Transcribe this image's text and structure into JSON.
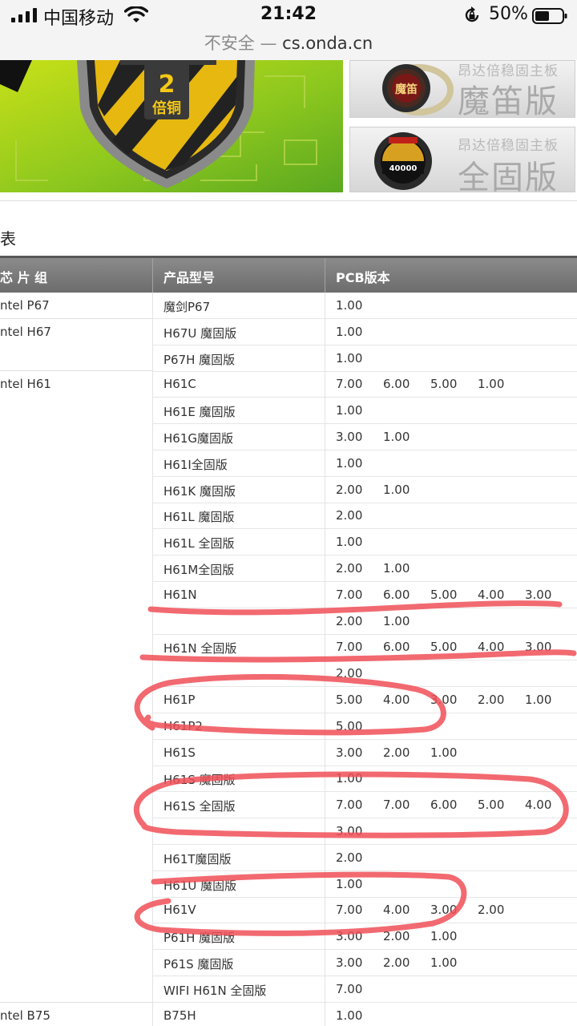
{
  "status_bar": {
    "carrier": "中国移动",
    "time": "21:42",
    "battery": "50%"
  },
  "address_bar": {
    "insecure": "不安全 —",
    "domain": "cs.onda.cn"
  },
  "banner": {
    "badge_top": "2",
    "badge_bottom": "倍铜",
    "thumbs": [
      {
        "sub": "昂达倍稳固主板",
        "title": "魔笛版",
        "badge": "魔笛"
      },
      {
        "sub": "昂达倍稳固主板",
        "title": "全固版",
        "badge": "40000"
      }
    ]
  },
  "section": {
    "title": "表"
  },
  "table": {
    "headers": [
      "芯片组",
      "产品型号",
      "PCB版本"
    ],
    "header_chip_visible": "芯 片 组",
    "groups": [
      {
        "chipset": "ntel P67",
        "start": 0,
        "span": 1
      },
      {
        "chipset": "ntel H67",
        "start": 1,
        "span": 2
      },
      {
        "chipset": "ntel H61",
        "start": 3,
        "span": 24
      },
      {
        "chipset": "ntel B75",
        "start": 27,
        "span": 1
      }
    ],
    "rows": [
      {
        "model": "魔剑P67",
        "versions": [
          "1.00"
        ]
      },
      {
        "model": "H67U 魔固版",
        "versions": [
          "1.00"
        ]
      },
      {
        "model": "P67H 魔固版",
        "versions": [
          "1.00"
        ]
      },
      {
        "model": "H61C",
        "versions": [
          "7.00",
          "6.00",
          "5.00",
          "1.00"
        ]
      },
      {
        "model": "H61E 魔固版",
        "versions": [
          "1.00"
        ]
      },
      {
        "model": "H61G魔固版",
        "versions": [
          "3.00",
          "1.00"
        ]
      },
      {
        "model": "H61I全固版",
        "versions": [
          "1.00"
        ]
      },
      {
        "model": "H61K 魔固版",
        "versions": [
          "2.00",
          "1.00"
        ]
      },
      {
        "model": "H61L 魔固版",
        "versions": [
          "2.00"
        ]
      },
      {
        "model": "H61L 全固版",
        "versions": [
          "1.00"
        ]
      },
      {
        "model": "H61M全固版",
        "versions": [
          "2.00",
          "1.00"
        ]
      },
      {
        "model": "H61N",
        "versions": [
          "7.00",
          "6.00",
          "5.00",
          "4.00",
          "3.00"
        ]
      },
      {
        "model": "",
        "versions": [
          "2.00",
          "1.00"
        ]
      },
      {
        "model": "H61N 全固版",
        "versions": [
          "7.00",
          "6.00",
          "5.00",
          "4.00",
          "3.00"
        ]
      },
      {
        "model": "",
        "versions": [
          "2.00"
        ]
      },
      {
        "model": "H61P",
        "versions": [
          "5.00",
          "4.00",
          "3.00",
          "2.00",
          "1.00"
        ]
      },
      {
        "model": "H61P2",
        "versions": [
          "5.00"
        ]
      },
      {
        "model": "H61S",
        "versions": [
          "3.00",
          "2.00",
          "1.00"
        ]
      },
      {
        "model": "H61S 魔固版",
        "versions": [
          "1.00"
        ]
      },
      {
        "model": "H61S 全固版",
        "versions": [
          "7.00",
          "7.00",
          "6.00",
          "5.00",
          "4.00"
        ]
      },
      {
        "model": "",
        "versions": [
          "3.00"
        ]
      },
      {
        "model": "H61T魔固版",
        "versions": [
          "2.00"
        ]
      },
      {
        "model": "H61U 魔固版",
        "versions": [
          "1.00"
        ]
      },
      {
        "model": "H61V",
        "versions": [
          "7.00",
          "4.00",
          "3.00",
          "2.00"
        ]
      },
      {
        "model": "P61H 魔固版",
        "versions": [
          "3.00",
          "2.00",
          "1.00"
        ]
      },
      {
        "model": "P61S 魔固版",
        "versions": [
          "3.00",
          "2.00",
          "1.00"
        ]
      },
      {
        "model": "WIFI H61N 全固版",
        "versions": [
          "7.00"
        ]
      },
      {
        "model": "B75H",
        "versions": [
          "1.00"
        ]
      }
    ]
  },
  "annotation_color": "#f05058"
}
